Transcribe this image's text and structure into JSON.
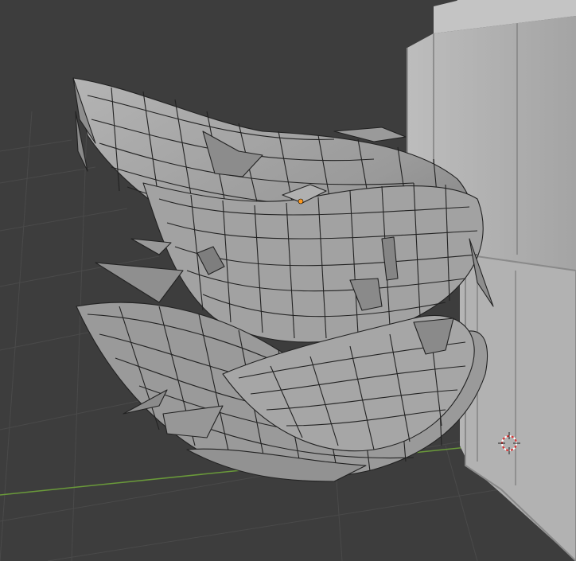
{
  "viewport": {
    "editor": "3D Viewport",
    "shading_mode": "edit-mode-wireframe-over-solid",
    "background_color": "#3d3d3d",
    "grid_color": "#4a4a4a",
    "x_axis_color": "#8a3a3a",
    "y_axis_color": "#6a9a3a",
    "mesh_color": "#9c9c9c",
    "wire_color": "#202020",
    "selected_vertex_color": "#ff9a1f"
  },
  "objects": [
    {
      "name_icon": "hair-mesh-object",
      "selected": true
    },
    {
      "name_icon": "character-body-object",
      "selected": false
    }
  ],
  "gizmos": {
    "cursor_icon": "3d-cursor-icon",
    "origin_icon": "object-origin-icon"
  }
}
